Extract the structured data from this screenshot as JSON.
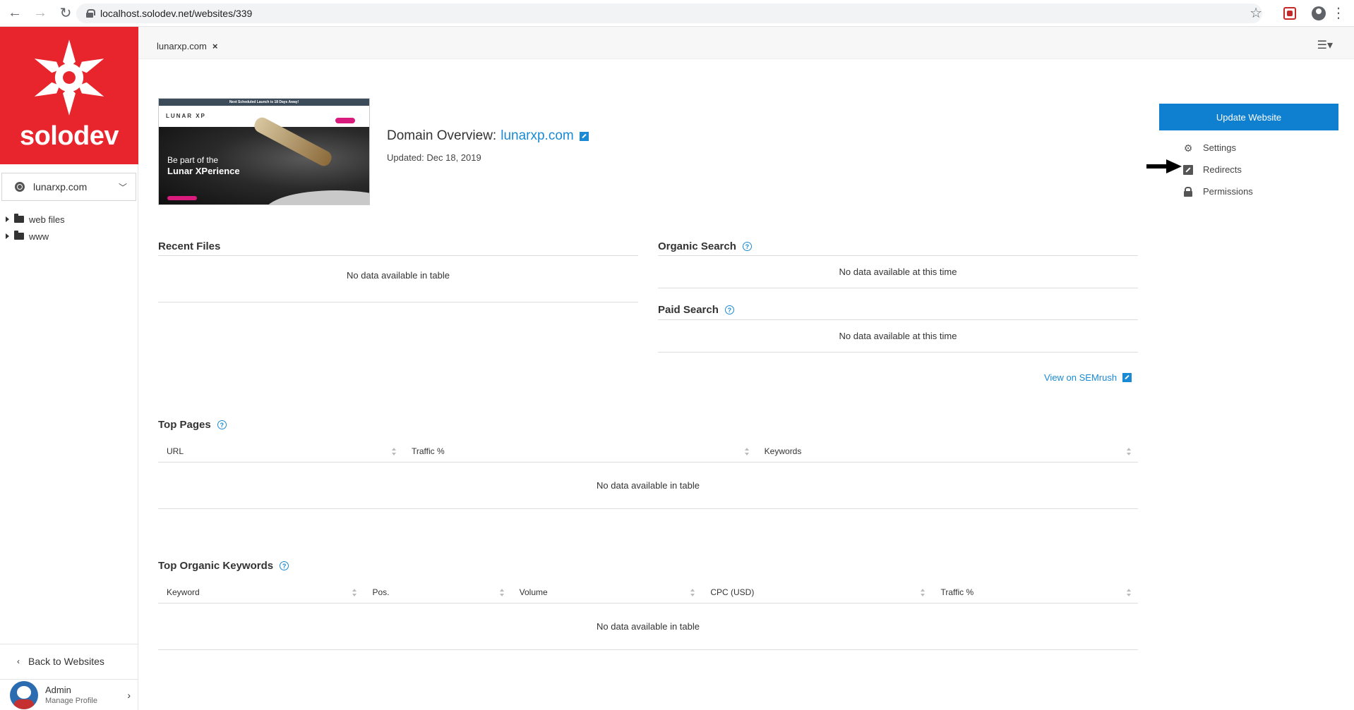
{
  "browser": {
    "url": "localhost.solodev.net/websites/339"
  },
  "sidebar": {
    "brand": "solodev",
    "site_selector": "lunarxp.com",
    "tree": [
      {
        "label": "web files"
      },
      {
        "label": "www"
      }
    ],
    "back_label": "Back to Websites",
    "user_name": "Admin",
    "user_sub": "Manage Profile"
  },
  "tabs": [
    {
      "label": "lunarxp.com"
    }
  ],
  "thumbnail": {
    "banner": "Next Scheduled Launch is 18 Days Away!",
    "brand": "LUNAR XP",
    "hero_line1": "Be part of the",
    "hero_line2": "Lunar XPerience"
  },
  "overview": {
    "prefix": "Domain Overview:",
    "domain": "lunarxp.com",
    "updated": "Updated: Dec 18, 2019"
  },
  "actions": {
    "update_label": "Update Website",
    "links": [
      {
        "label": "Settings",
        "icon": "gear-icon"
      },
      {
        "label": "Redirects",
        "icon": "redirect-icon"
      },
      {
        "label": "Permissions",
        "icon": "lock-icon"
      }
    ]
  },
  "recent_files": {
    "title": "Recent Files",
    "empty": "No data available in table"
  },
  "organic_search": {
    "title": "Organic Search",
    "empty": "No data available at this time"
  },
  "paid_search": {
    "title": "Paid Search",
    "empty": "No data available at this time"
  },
  "semrush_link": "View on SEMrush",
  "top_pages": {
    "title": "Top Pages",
    "columns": [
      "URL",
      "Traffic %",
      "Keywords"
    ],
    "empty": "No data available in table"
  },
  "top_keywords": {
    "title": "Top Organic Keywords",
    "columns": [
      "Keyword",
      "Pos.",
      "Volume",
      "CPC (USD)",
      "Traffic %"
    ],
    "empty": "No data available in table"
  },
  "colors": {
    "brand_red": "#e8242c",
    "primary_blue": "#0f7fcf",
    "link_blue": "#1a8ad4"
  }
}
